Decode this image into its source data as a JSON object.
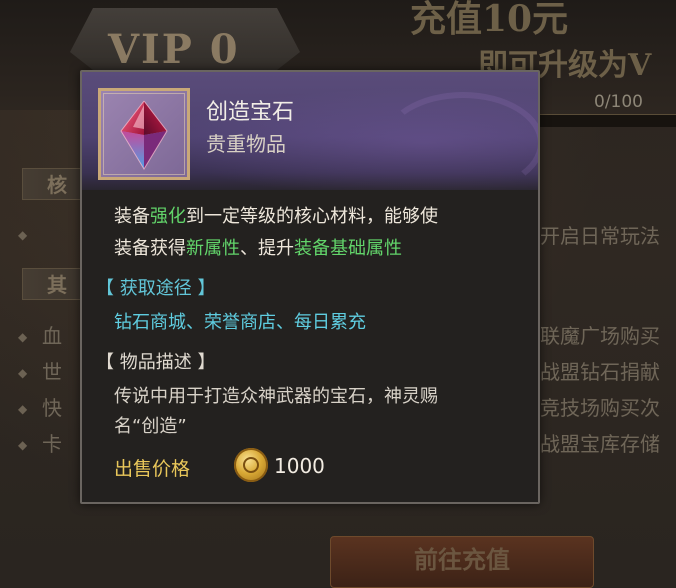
{
  "background": {
    "vip_label": "VIP 0",
    "recharge_title": "充值10元",
    "recharge_subtitle": "即可升级为V",
    "progress": {
      "text": "0/100",
      "fraction": 0.0
    },
    "sections": [
      {
        "label": "核"
      },
      {
        "label": "其"
      }
    ],
    "left_rows": [
      "血",
      "世",
      "快",
      "卡"
    ],
    "right_rows": [
      "开启日常玩法",
      "联魔广场购买",
      "战盟钻石捐献",
      "竞技场购买次",
      "战盟宝库存储"
    ],
    "goto_button_label": "前往充值"
  },
  "tooltip": {
    "item_name": "创造宝石",
    "item_type": "贵重物品",
    "item_icon": "red-gem-icon",
    "effect": {
      "line1": [
        {
          "text": "装备",
          "style": "normal"
        },
        {
          "text": "强化",
          "style": "green"
        },
        {
          "text": "到一定等级的核心材料，能够使",
          "style": "normal"
        }
      ],
      "line2": [
        {
          "text": "装备获得",
          "style": "normal"
        },
        {
          "text": "新属性",
          "style": "green"
        },
        {
          "text": "、提升",
          "style": "normal"
        },
        {
          "text": "装备基础属性",
          "style": "green"
        }
      ]
    },
    "obtain": {
      "header": "【 获取途径 】",
      "text": "钻石商城、荣誉商店、每日累充"
    },
    "description": {
      "header": "【 物品描述 】",
      "line1": "传说中用于打造众神武器的宝石，神灵赐",
      "line2": "名“创造”"
    },
    "sell": {
      "label": "出售价格",
      "currency_icon": "gold-coin-icon",
      "price": "1000"
    }
  },
  "colors": {
    "highlight_green": "#62d46a",
    "section_cyan": "#5fcde0",
    "price_gold": "#e9c75a",
    "header_purple": "#5a4c7a"
  }
}
